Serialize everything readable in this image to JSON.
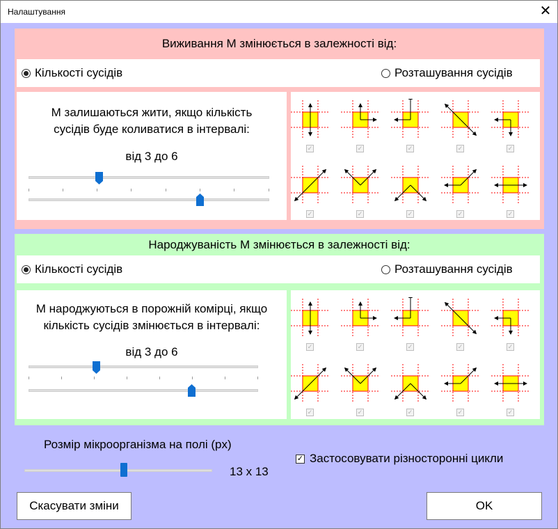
{
  "window": {
    "title": "Налаштування",
    "close_glyph": "✕"
  },
  "survival": {
    "heading": "Виживання М змінюється в залежності від:",
    "radio_count": "Кількості сусідів",
    "radio_position": "Розташування сусідів",
    "description_line1": "М залишаються жити, якщо кількість",
    "description_line2": "сусідів буде коливатися в інтервалі:",
    "range_text": "від 3 до 6",
    "min_value": 3,
    "max_value": 6
  },
  "birth": {
    "heading": "Народжуваність М змінюється в залежності від:",
    "radio_count": "Кількості сусідів",
    "radio_position": "Розташування сусідів",
    "description_line1": "М народжуються в порожній комірці, якщо",
    "description_line2": "кількість сусідів змінюється в інтервалі:",
    "range_text": "від 3 до 6",
    "min_value": 3,
    "max_value": 6
  },
  "size": {
    "label": "Розмір мікроорганізма на полі (px)",
    "value_text": "13 x 13",
    "value": 13
  },
  "options": {
    "two_sided_cycles": "Застосовувати різносторонні цикли",
    "two_sided_checked": true
  },
  "buttons": {
    "cancel": "Скасувати зміни",
    "ok": "OK"
  },
  "colors": {
    "window_bg": "#bdbdff",
    "survival_bg": "#ffc3c3",
    "birth_bg": "#c3ffc3",
    "cell_fill": "#ffff00",
    "grid_line": "#ff0000",
    "slider_thumb": "#0f6fd1"
  },
  "neighbor_patterns": [
    {
      "icon": "up-down-arrows-icon",
      "checked": true
    },
    {
      "icon": "up-right-arrows-icon",
      "checked": true
    },
    {
      "icon": "up-up-left-arrows-icon",
      "checked": true
    },
    {
      "icon": "upleft-downright-arrows-icon",
      "checked": true
    },
    {
      "icon": "left-down-arrows-icon",
      "checked": true
    },
    {
      "icon": "upright-downleft-arrows-icon",
      "checked": true
    },
    {
      "icon": "upleft-upright-arrows-icon",
      "checked": true
    },
    {
      "icon": "downleft-downright-arrows-icon",
      "checked": true
    },
    {
      "icon": "left-upright-arrows-icon",
      "checked": true
    },
    {
      "icon": "left-right-arrows-icon",
      "checked": true
    }
  ]
}
